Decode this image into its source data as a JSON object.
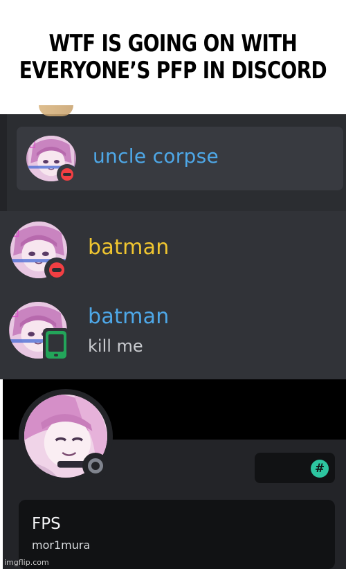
{
  "caption": {
    "line1": "WTF IS GOING ON WITH",
    "line2": "EVERYONE’S PFP IN DISCORD"
  },
  "panel1": {
    "member": {
      "name": "uncle corpse",
      "name_color": "#4ea8e8",
      "status": "dnd"
    }
  },
  "panel2": {
    "entries": [
      {
        "name": "batman",
        "name_color": "#f0c630",
        "status": "dnd"
      },
      {
        "name": "batman",
        "name_color": "#4ea8e8",
        "status": "mobile",
        "message": "kill me"
      }
    ]
  },
  "profile": {
    "display_name": "FPS",
    "handle": "mor1mura",
    "status": "offline",
    "badge_icon": "hashtag-icon",
    "badge_symbol": "#",
    "accent_color": "#2dc5a0"
  },
  "watermark": "imgflip.com",
  "colors": {
    "dnd": "#f23f43",
    "mobile": "#23a55a",
    "offline": "#80848e"
  }
}
